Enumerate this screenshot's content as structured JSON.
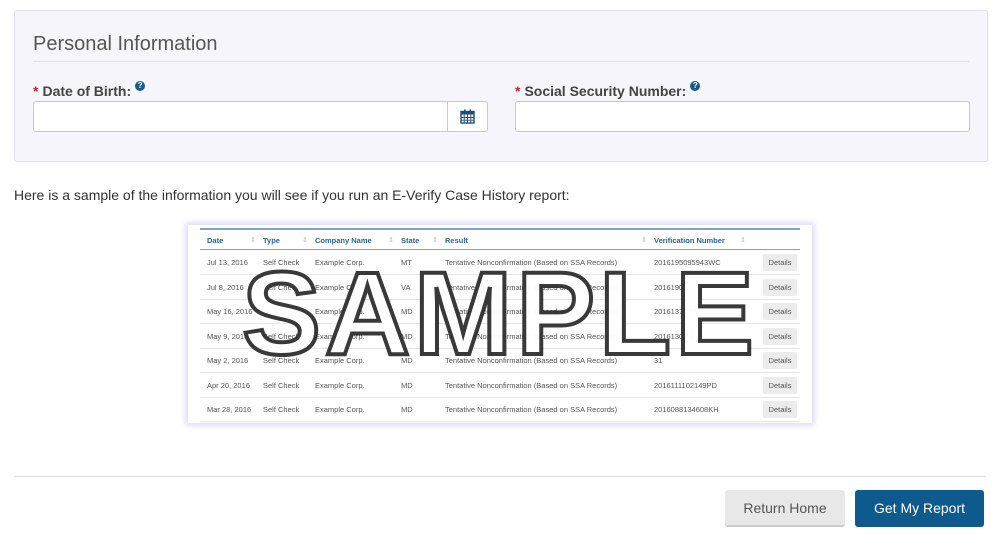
{
  "personal_info": {
    "title": "Personal Information",
    "dob_label": "Date of Birth:",
    "ssn_label": "Social Security Number:",
    "required_marker": "*",
    "help_icon": "?",
    "dob_value": "",
    "ssn_value": ""
  },
  "intro_text": "Here is a sample of the information you will see if you run an E-Verify Case History report:",
  "sample": {
    "watermark": "SAMPLE",
    "columns": [
      "Date",
      "Type",
      "Company Name",
      "State",
      "Result",
      "Verification Number"
    ],
    "details_label": "Details",
    "rows": [
      [
        "Jul 13, 2016",
        "Self Check",
        "Example Corp.",
        "MT",
        "Tentative Nonconfirmation (Based on SSA Records)",
        "2016195095943WC"
      ],
      [
        "Jul 8, 2016",
        "Self Check",
        "Example Corp.",
        "VA",
        "Tentative Nonconfirmation (Based on SSA Records)",
        "2016190"
      ],
      [
        "May 16, 2016",
        "Self Check",
        "Example Corp.",
        "MD",
        "Tentative Nonconfirmation (Based on SSA Records)",
        "20161371     YM"
      ],
      [
        "May 9, 2016",
        "Self Check",
        "Example Corp.",
        "MD",
        "Tentative Nonconfirmation (Based on SSA Records)",
        "20161301      Z"
      ],
      [
        "May 2, 2016",
        "Self Check",
        "Example Corp.",
        "MD",
        "Tentative Nonconfirmation (Based on SSA Records)",
        "      31"
      ],
      [
        "Apr 20, 2016",
        "Self Check",
        "Example Corp.",
        "MD",
        "Tentative Nonconfirmation (Based on SSA Records)",
        "2016111102149PD"
      ],
      [
        "Mar 28, 2016",
        "Self Check",
        "Example Corp.",
        "MD",
        "Tentative Nonconfirmation (Based on SSA Records)",
        "2016088134608KH"
      ]
    ]
  },
  "buttons": {
    "return_home": "Return Home",
    "get_report": "Get My Report"
  },
  "colors": {
    "primary": "#0f5a8c",
    "required": "#c0282d",
    "panel_bg": "#f6f5fc"
  }
}
